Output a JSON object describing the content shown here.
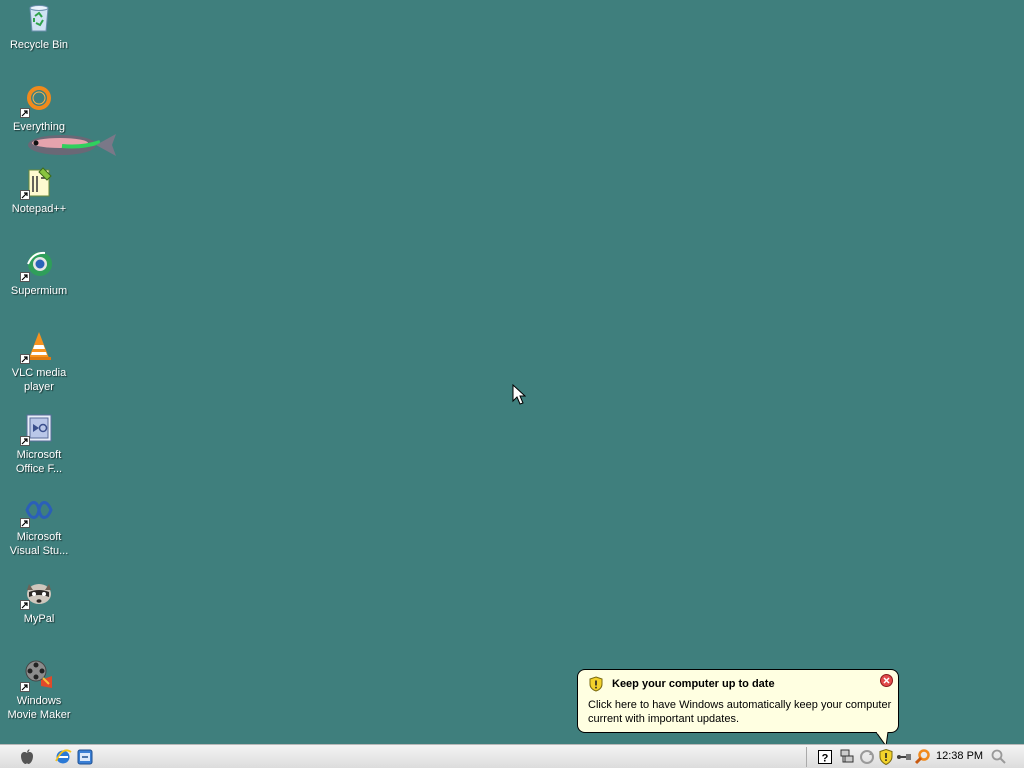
{
  "desktop": {
    "icons": [
      {
        "label": "Recycle Bin",
        "icon": "recycle-bin-icon"
      },
      {
        "label": "Everything",
        "icon": "everything-search-icon"
      },
      {
        "label": "Notepad++",
        "icon": "notepadpp-icon"
      },
      {
        "label": "Supermium",
        "icon": "supermium-browser-icon"
      },
      {
        "label": "VLC media\nplayer",
        "icon": "vlc-cone-icon"
      },
      {
        "label": "Microsoft\nOffice F...",
        "icon": "office-icon"
      },
      {
        "label": "Microsoft\nVisual Stu...",
        "icon": "visual-studio-icon"
      },
      {
        "label": "MyPal",
        "icon": "mypal-raccoon-icon"
      },
      {
        "label": "Windows\nMovie Maker",
        "icon": "movie-maker-icon"
      }
    ],
    "background_color": "#3f7f7d"
  },
  "balloon": {
    "title": "Keep your computer up to date",
    "body": "Click here to have Windows automatically keep your computer current with important updates.",
    "icon": "security-shield-icon",
    "bg_color": "#ffffe1"
  },
  "taskbar": {
    "start_icon": "apple-logo-icon",
    "quick_launch": [
      "internet-explorer-icon",
      "show-desktop-icon"
    ],
    "tray_icons": [
      "help-icon",
      "network-icon",
      "sync-icon",
      "security-shield-icon",
      "usb-icon",
      "search-magnifier-icon"
    ],
    "clock": "12:38 PM"
  }
}
